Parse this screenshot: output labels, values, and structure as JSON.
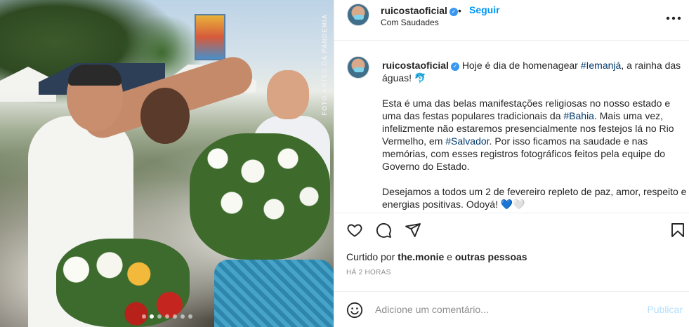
{
  "post": {
    "username": "ruicostaoficial",
    "verified_mark": "✓",
    "separator": "•",
    "follow_label": "Seguir",
    "location": "Com Saudades",
    "more_icon": "more-options-icon",
    "photo": {
      "watermark": "FOTO ANTES DA PANDEMIA",
      "slide_count": 7,
      "active_slide": 2
    }
  },
  "caption": {
    "username": "ruicostaoficial",
    "line1_pre": "Hoje é dia de homenagear ",
    "tag_iemanja": "#Iemanjá",
    "line1_post": ", a rainha das águas! 🐬",
    "p2_pre": "Esta é uma das belas manifestações religiosas no nosso estado e uma das festas populares tradicionais da ",
    "tag_bahia": "#Bahia",
    "p2_mid": ". Mais uma vez, infelizmente não estaremos presencialmente nos festejos lá no Rio Vermelho, em ",
    "tag_salvador": "#Salvador",
    "p2_post": ". Por isso ficamos na saudade e nas memórias, com esses registros fotográficos feitos pela equipe do Governo do Estado.",
    "p3": "Desejamos a todos um 2 de fevereiro repleto de paz, amor, respeito e energias positivas. Odoyá! ",
    "p3_hearts": "💙🤍"
  },
  "actions": {
    "like_icon": "heart-icon",
    "comment_icon": "comment-icon",
    "share_icon": "share-icon",
    "save_icon": "bookmark-icon"
  },
  "likes": {
    "prefix": "Curtido por ",
    "user": "the.monie",
    "middle": " e ",
    "others": "outras pessoas"
  },
  "timestamp": "HÁ 2 HORAS",
  "comment": {
    "placeholder": "Adicione um comentário...",
    "publish_label": "Publicar"
  },
  "colors": {
    "link_blue": "#0095f6",
    "hashtag": "#00376b",
    "publish_disabled": "#b2dffc",
    "muted": "#8e8e8e"
  }
}
